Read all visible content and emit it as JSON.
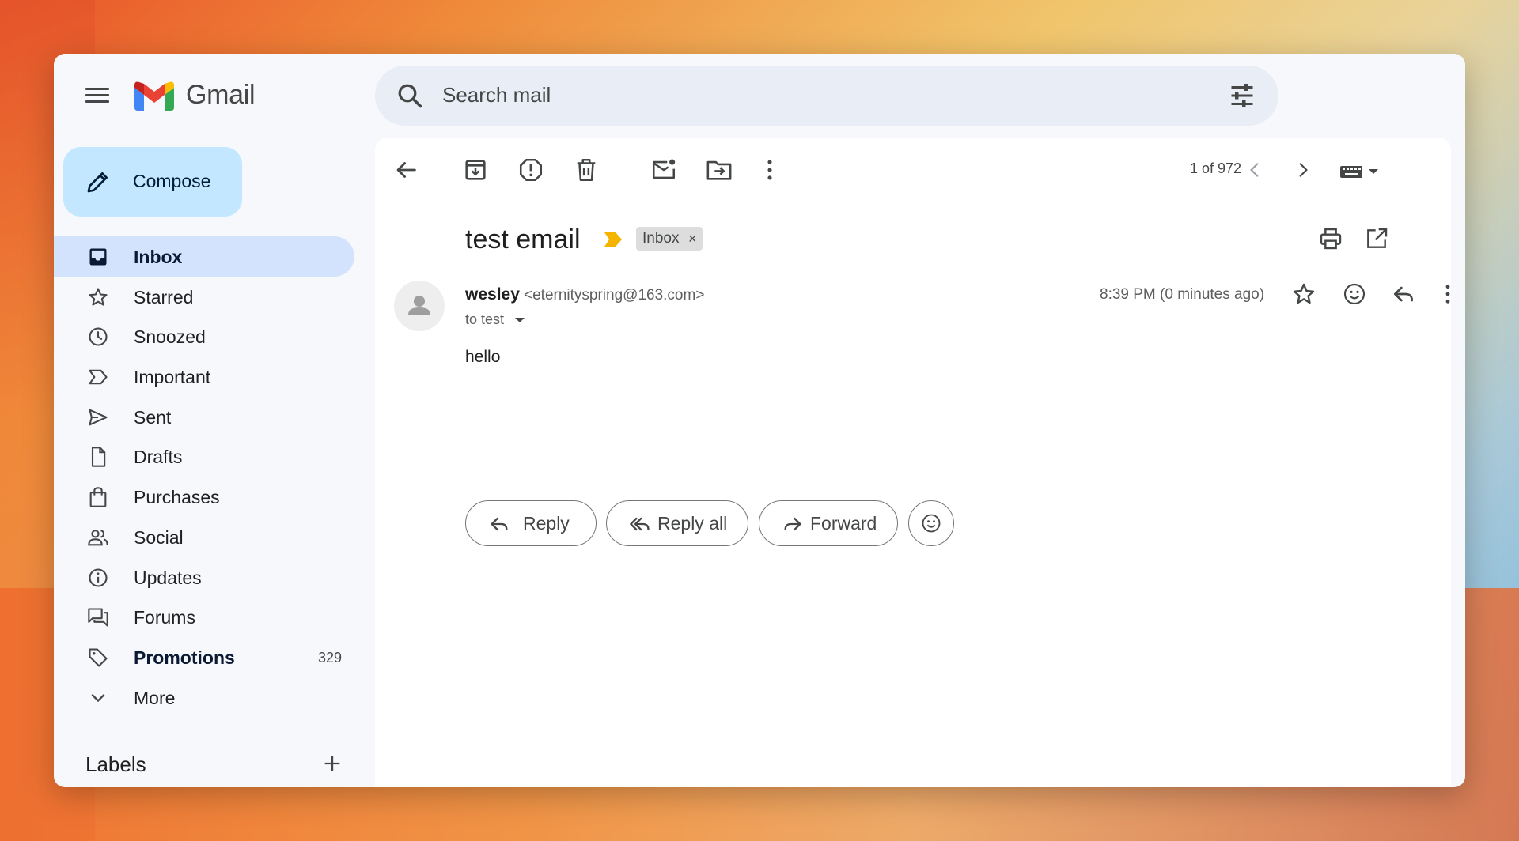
{
  "app": {
    "name": "Gmail"
  },
  "search": {
    "placeholder": "Search mail"
  },
  "compose": {
    "label": "Compose"
  },
  "sidebar": {
    "items": [
      {
        "label": "Inbox",
        "icon": "inbox-icon",
        "active": true
      },
      {
        "label": "Starred",
        "icon": "star-icon"
      },
      {
        "label": "Snoozed",
        "icon": "clock-icon"
      },
      {
        "label": "Important",
        "icon": "important-icon"
      },
      {
        "label": "Sent",
        "icon": "send-icon"
      },
      {
        "label": "Drafts",
        "icon": "draft-icon"
      },
      {
        "label": "Purchases",
        "icon": "shopping-bag-icon"
      },
      {
        "label": "Social",
        "icon": "people-icon"
      },
      {
        "label": "Updates",
        "icon": "info-icon"
      },
      {
        "label": "Forums",
        "icon": "forum-icon"
      },
      {
        "label": "Promotions",
        "icon": "tag-icon",
        "count": "329",
        "bold": true
      },
      {
        "label": "More",
        "icon": "chevron-down-icon"
      }
    ],
    "labels_heading": "Labels"
  },
  "toolbar": {
    "pager": "1 of 972"
  },
  "message": {
    "subject": "test email",
    "label_chip": "Inbox",
    "label_chip_close": "×",
    "sender_name": "wesley",
    "sender_email": "<eternityspring@163.com>",
    "to": "to test",
    "time": "8:39 PM (0 minutes ago)",
    "body": "hello"
  },
  "actions": {
    "reply": "Reply",
    "reply_all": "Reply all",
    "forward": "Forward"
  },
  "colors": {
    "compose_bg": "#c2e7ff",
    "active_nav_bg": "#d3e3fd",
    "search_bg": "#e9eef6",
    "important_marker": "#f4b400"
  }
}
